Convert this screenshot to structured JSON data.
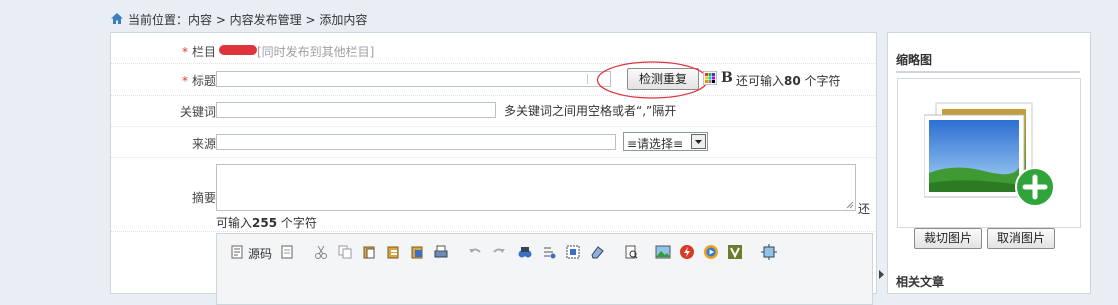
{
  "breadcrumb": {
    "text": "当前位置：内容 > 内容发布管理 > 添加内容"
  },
  "form": {
    "column": {
      "label": "栏目",
      "hint": "[同时发布到其他栏目]"
    },
    "title": {
      "label": "标题",
      "check_button": "检测重复",
      "bold_glyph": "B",
      "count_prefix": "还可输入",
      "count_value": "80",
      "count_suffix": " 个字符"
    },
    "keywords": {
      "label": "关键词",
      "hint": "多关键词之间用空格或者“,”隔开"
    },
    "source": {
      "label": "来源",
      "select_value": "≡请选择≡"
    },
    "summary": {
      "label": "摘要",
      "trailing": "还",
      "count_prefix": "可输入",
      "count_value": "255",
      "count_suffix": " 个字符"
    },
    "toolbar": {
      "source_label": "源码"
    }
  },
  "sidebar": {
    "thumbnail_title": "缩略图",
    "crop_button": "裁切图片",
    "cancel_button": "取消图片",
    "related_title": "相关文章"
  },
  "colors": {
    "required": "#e03c2c",
    "annotation": "#e0343c",
    "plus_badge": "#2fa43a"
  }
}
